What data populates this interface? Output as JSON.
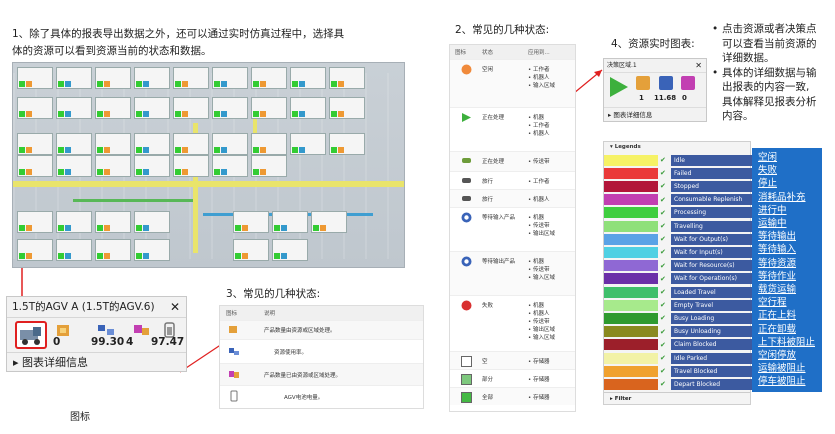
{
  "section1": {
    "title_line1": "1、除了具体的报表导出数据之外，还可以通过实时仿真过程中，选择具",
    "title_line2": "体的资源可以看到资源当前的状态和数据。"
  },
  "agv_panel": {
    "title": "1.5T的AGV A (1.5T的AGV.6)",
    "close": "✕",
    "values": [
      "0",
      "99.30",
      "4",
      "97.47"
    ],
    "details_label": "图表详细信息",
    "caption": "图标"
  },
  "section2": {
    "title": "2、常见的几种状态:",
    "headers": [
      "图标",
      "状态",
      "应用到..."
    ],
    "rows": [
      {
        "state": "空闲",
        "apply": [
          "工作者",
          "机器人",
          "输入区域"
        ],
        "icon": "idle-circle-icon",
        "color": "#f08a3b"
      },
      {
        "state": "正在处理",
        "apply": [
          "机器",
          "工作者",
          "机器人"
        ],
        "icon": "play-icon",
        "color": "#3db03d"
      },
      {
        "state": "正在处理",
        "apply": [
          "传送带"
        ],
        "icon": "conveyor-icon",
        "color": "#6d9c3a"
      },
      {
        "state": "旅行",
        "apply": [
          "工作者"
        ],
        "icon": "walker-icon",
        "color": "#555555"
      },
      {
        "state": "旅行",
        "apply": [
          "机器人"
        ],
        "icon": "robot-icon",
        "color": "#555555"
      },
      {
        "state": "等待输入产品",
        "apply": [
          "机器",
          "传送带",
          "输出区域"
        ],
        "icon": "wait-input-icon",
        "color": "#3a63b8"
      },
      {
        "state": "等待输出产品",
        "apply": [
          "机器",
          "传送带",
          "输入区域"
        ],
        "icon": "wait-output-icon",
        "color": "#3a63b8"
      },
      {
        "state": "失败",
        "apply": [
          "机器",
          "机器人",
          "传送带",
          "输出区域",
          "输入区域"
        ],
        "icon": "failed-icon",
        "color": "#d93030"
      },
      {
        "state": "空",
        "apply": [
          "存储器"
        ],
        "icon": "empty-box-icon",
        "color": "#ffffff"
      },
      {
        "state": "部分",
        "apply": [
          "存储器"
        ],
        "icon": "partial-box-icon",
        "color": "#7ec97e"
      },
      {
        "state": "全部",
        "apply": [
          "存储器"
        ],
        "icon": "full-box-icon",
        "color": "#44b944"
      }
    ]
  },
  "section3": {
    "title": "3、常见的几种状态:",
    "headers": [
      "图标",
      "说明"
    ],
    "rows": [
      {
        "text": "产品数量由资源或区域处理。"
      },
      {
        "text": "资源使用率。"
      },
      {
        "text": "产品数量已由资源或区域处理。"
      },
      {
        "text": "AGV电池电量。"
      }
    ]
  },
  "section4": {
    "title": "4、资源实时图表:",
    "bullets": [
      [
        "点击资源或者决策点",
        "可以查看当前资源的",
        "详细数据。"
      ],
      [
        "具体的详细数据与输",
        "出报表的内容一致,",
        "具体解释见报表分析",
        "内容。"
      ]
    ],
    "panel": {
      "title": "决策区域.1",
      "close": "✕",
      "values": [
        "1",
        "11.68",
        "0"
      ],
      "details_label": "图表详细信息"
    }
  },
  "legend": {
    "header": "Legends",
    "filter": "Filter",
    "items": [
      {
        "en": "Idle",
        "cn": "空闲",
        "color": "#f6f266"
      },
      {
        "en": "Failed",
        "cn": "失败",
        "color": "#ea3a3a"
      },
      {
        "en": "Stopped",
        "cn": "停止",
        "color": "#b2163a"
      },
      {
        "en": "Consumable Replenish",
        "cn": "消耗品补充",
        "color": "#c23fb2"
      },
      {
        "en": "Processing",
        "cn": "进行中",
        "color": "#3fce3f"
      },
      {
        "en": "Travelling",
        "cn": "运输中",
        "color": "#8fe07a"
      },
      {
        "en": "Wait for Output(s)",
        "cn": "等待输出",
        "color": "#5aa2e6"
      },
      {
        "en": "Wait for Input(s)",
        "cn": "等待输入",
        "color": "#4fd0e3"
      },
      {
        "en": "Wait for Resource(s)",
        "cn": "等待资源",
        "color": "#8f68d4"
      },
      {
        "en": "Wait for Operation(s)",
        "cn": "等待作业",
        "color": "#6b2fa8"
      },
      {
        "en": "Loaded Travel",
        "cn": "载货运输",
        "color": "#3fbf6b"
      },
      {
        "en": "Empty Travel",
        "cn": "空行程",
        "color": "#a7ea8c"
      },
      {
        "en": "Busy Loading",
        "cn": "正在上料",
        "color": "#2f9a2f"
      },
      {
        "en": "Busy Unloading",
        "cn": "正在卸载",
        "color": "#8a8a1f"
      },
      {
        "en": "Claim Blocked",
        "cn": "上下料被阻止",
        "color": "#9c1f2a"
      },
      {
        "en": "Idle Parked",
        "cn": "空闲停放",
        "color": "#f2f2a6"
      },
      {
        "en": "Travel Blocked",
        "cn": "运输被阻止",
        "color": "#f0a12f"
      },
      {
        "en": "Depart Blocked",
        "cn": "停车被阻止",
        "color": "#d9641e"
      }
    ]
  }
}
